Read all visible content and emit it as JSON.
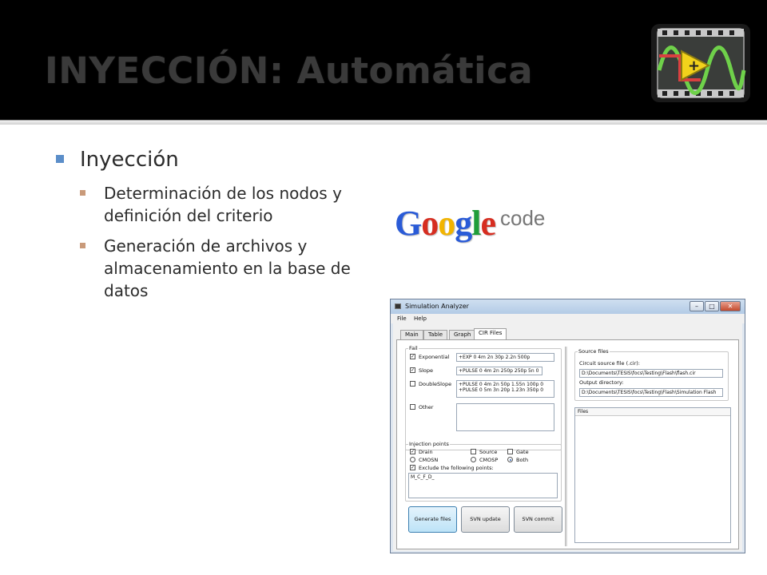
{
  "slide": {
    "title": "INYECCIÓN: Automática",
    "bullet_l1": "Inyección",
    "bullets_l2": [
      "Determinación de los nodos y definición del criterio",
      "Generación de archivos y almacenamiento en la base de datos"
    ]
  },
  "google_code": {
    "brand": "Google",
    "suffix": "code"
  },
  "app": {
    "window_title": "Simulation Analyzer",
    "menu": [
      "File",
      "Help"
    ],
    "tabs": [
      "Main",
      "Table",
      "Graph",
      "CIR Files"
    ],
    "active_tab": "CIR Files",
    "fail": {
      "label": "Fail",
      "rows": [
        {
          "name": "Exponential",
          "checked": true,
          "value": "+EXP 0 4m 2n 30p 2.2n 500p"
        },
        {
          "name": "Slope",
          "checked": true,
          "value": "+PULSE 0 4m 2n 250p 250p 5n 0"
        },
        {
          "name": "DoubleSlope",
          "checked": false,
          "value_line1": "+PULSE 0 4m 2n 50p 1.55n 100p 0",
          "value_line2": "+PULSE 0 5m 3n 20p 1.23n 350p 0"
        },
        {
          "name": "Other",
          "checked": false,
          "value": ""
        }
      ]
    },
    "injection": {
      "label": "Injection points",
      "drain": "Drain",
      "source": "Source",
      "gate": "Gate",
      "cmosn": "CMOSN",
      "cmosp": "CMOSP",
      "both": "Both",
      "exclude": "Exclude the following points:",
      "exclude_value": "M_C_F_D_"
    },
    "buttons": {
      "generate": "Generate files",
      "svn_update": "SVN update",
      "svn_commit": "SVN commit"
    },
    "source_files": {
      "label": "Source files",
      "circuit_label": "Circuit source file (.cir):",
      "circuit_value": "D:\\Documents\\TESIS\\focs\\Testing\\Flash\\flash.cir",
      "output_label": "Output directory:",
      "output_value": "D:\\Documents\\TESIS\\focs\\Testing\\Flash\\Simulation Flash"
    },
    "files_label": "Files"
  },
  "colors": {
    "header_bg": "#000000",
    "l1_bullet": "#5b8ec9",
    "l2_bullet": "#c99a7a"
  }
}
